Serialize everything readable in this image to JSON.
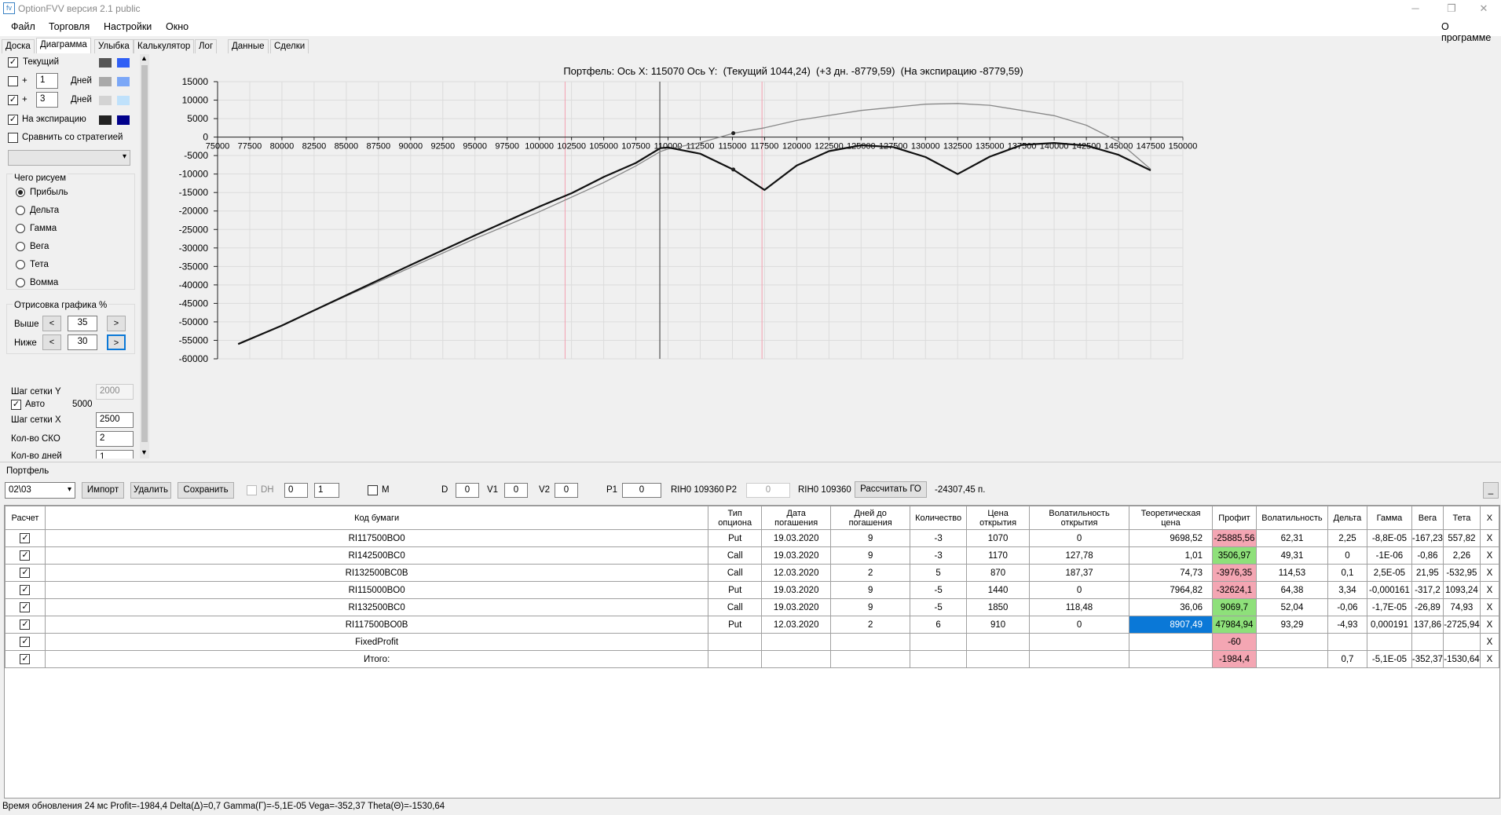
{
  "window": {
    "title": "OptionFVV версия 2.1 public",
    "minimize": "─",
    "restore": "❐",
    "close": "✕"
  },
  "menu": {
    "items": [
      "Файл",
      "Торговля",
      "Настройки",
      "Окно"
    ],
    "about": "О программе"
  },
  "tabs": [
    "Доска",
    "Диаграмма",
    "Улыбка",
    "Калькулятор",
    "Лог",
    "Данные",
    "Сделки"
  ],
  "left": {
    "current": {
      "label": "Текущий",
      "checked": true,
      "colors": [
        "#555555",
        "#2f5ff5"
      ]
    },
    "plus1": {
      "plus": "+",
      "days": "1",
      "unit": "Дней",
      "checked": false,
      "colors": [
        "#a9a9a9",
        "#7ba7f7"
      ]
    },
    "plus3": {
      "plus": "+",
      "days": "3",
      "unit": "Дней",
      "checked": true,
      "colors": [
        "#d3d3d3",
        "#bfe1fb"
      ]
    },
    "expiry": {
      "label": "На экспирацию",
      "checked": true,
      "colors": [
        "#222222",
        "#00008b"
      ]
    },
    "compare": {
      "label": "Сравнить со стратегией",
      "checked": false
    },
    "draw_group": "Чего рисуем",
    "radios": [
      "Прибыль",
      "Дельта",
      "Гамма",
      "Вега",
      "Тета",
      "Вомма"
    ],
    "selected_radio": "Прибыль",
    "render_group": "Отрисовка графика %",
    "above_label": "Выше",
    "above_value": "35",
    "below_label": "Ниже",
    "below_value": "30",
    "prev": "<",
    "next": ">",
    "grid_y_label": "Шаг сетки Y",
    "grid_y_value": "2000",
    "auto_label": "Авто",
    "auto_value": "5000",
    "auto_checked": true,
    "grid_x_label": "Шаг сетки X",
    "grid_x_value": "2500",
    "sko_label": "Кол-во СКО",
    "sko_value": "2",
    "days_label": "Кол-во дней",
    "days_value": "1"
  },
  "chart_data": {
    "type": "line",
    "title": "Портфель: Ось X: 115070 Ось Y:  (Текущий 1044,24)  (+3 дн. -8779,59)  (На экспирацию -8779,59)",
    "xlim": [
      75000,
      150000
    ],
    "ylim": [
      -60000,
      15000
    ],
    "x_ticks": [
      "75000",
      "77500",
      "80000",
      "82500",
      "85000",
      "87500",
      "90000",
      "92500",
      "95000",
      "97500",
      "100000",
      "102500",
      "105000",
      "107500",
      "110000",
      "112500",
      "115000",
      "117500",
      "120000",
      "122500",
      "125000",
      "127500",
      "130000",
      "132500",
      "135000",
      "137500",
      "140000",
      "142500",
      "145000",
      "147500",
      "150000"
    ],
    "y_ticks": [
      "15000",
      "10000",
      "5000",
      "0",
      "-5000",
      "-10000",
      "-15000",
      "-20000",
      "-25000",
      "-30000",
      "-35000",
      "-40000",
      "-45000",
      "-50000",
      "-55000",
      "-60000"
    ],
    "cursor_x": 109360,
    "pink_lines": [
      102000,
      117300
    ],
    "series": [
      {
        "color": "#888888",
        "x": [
          76600,
          80000,
          85000,
          90000,
          95000,
          100000,
          105000,
          107500,
          109400,
          110000,
          112500,
          115070,
          117500,
          120000,
          125000,
          130000,
          132500,
          135000,
          140000,
          142500,
          145000,
          147500
        ],
        "y": [
          -56000,
          -51000,
          -43000,
          -35300,
          -27500,
          -20200,
          -12300,
          -7800,
          -3900,
          -3200,
          -1500,
          1044,
          2500,
          4500,
          7200,
          8900,
          9100,
          8600,
          5800,
          3200,
          -1200,
          -8700
        ]
      },
      {
        "color": "#111111",
        "x": [
          76600,
          80000,
          85000,
          90000,
          95000,
          100000,
          102500,
          105000,
          107500,
          109400,
          110000,
          112500,
          115070,
          117500,
          120000,
          122500,
          125000,
          127500,
          130000,
          132500,
          135000,
          137500,
          140000,
          142500,
          145000,
          147500
        ],
        "y": [
          -56000,
          -51000,
          -42800,
          -34600,
          -26600,
          -18800,
          -15200,
          -10800,
          -7000,
          -3000,
          -2800,
          -4500,
          -8800,
          -14300,
          -7700,
          -3800,
          -2200,
          -2700,
          -5400,
          -10000,
          -5300,
          -2100,
          -1600,
          -2300,
          -4800,
          -9000
        ]
      }
    ],
    "markers": [
      {
        "x": 115070,
        "y": 1044
      },
      {
        "x": 115070,
        "y": -8780
      }
    ]
  },
  "portfolio": {
    "label": "Портфель",
    "date": "02\\03",
    "buttons": {
      "import": "Импорт",
      "delete": "Удалить",
      "save": "Сохранить",
      "calc": "Рассчитать ГО",
      "minimize": "_"
    },
    "dh": "DH",
    "dh_v1": "0",
    "dh_v2": "1",
    "m": "M",
    "d_label": "D",
    "d_value": "0",
    "v1_label": "V1",
    "v1_value": "0",
    "v2_label": "V2",
    "v2_value": "0",
    "p1_label": "P1",
    "p1_value": "0",
    "rih1": "RIH0 109360",
    "p2_label": "P2",
    "p2_value": "0",
    "rih2": "RIH0 109360",
    "go_result": "-24307,45 п."
  },
  "table": {
    "headers": [
      "Расчет",
      "Код бумаги",
      "Тип\nопциона",
      "Дата\nпогашения",
      "Дней до\nпогашения",
      "Количество",
      "Цена\nоткрытия",
      "Волатильность\nоткрытия",
      "Теоретическая\nцена",
      "Профит",
      "Волатильность",
      "Дельта",
      "Гамма",
      "Вега",
      "Тета",
      "X"
    ],
    "rows": [
      [
        "RI117500BO0",
        "Put",
        "19.03.2020",
        "9",
        "-3",
        "1070",
        "0",
        "9698,52",
        "-25885,56",
        "62,31",
        "2,25",
        "-8,8E-05",
        "-167,23",
        "557,82"
      ],
      [
        "RI142500BC0",
        "Call",
        "19.03.2020",
        "9",
        "-3",
        "1170",
        "127,78",
        "1,01",
        "3506,97",
        "49,31",
        "0",
        "-1E-06",
        "-0,86",
        "2,26"
      ],
      [
        "RI132500BC0B",
        "Call",
        "12.03.2020",
        "2",
        "5",
        "870",
        "187,37",
        "74,73",
        "-3976,35",
        "114,53",
        "0,1",
        "2,5E-05",
        "21,95",
        "-532,95"
      ],
      [
        "RI115000BO0",
        "Put",
        "19.03.2020",
        "9",
        "-5",
        "1440",
        "0",
        "7964,82",
        "-32624,1",
        "64,38",
        "3,34",
        "-0,000161",
        "-317,2",
        "1093,24"
      ],
      [
        "RI132500BC0",
        "Call",
        "19.03.2020",
        "9",
        "-5",
        "1850",
        "118,48",
        "36,06",
        "9069,7",
        "52,04",
        "-0,06",
        "-1,7E-05",
        "-26,89",
        "74,93"
      ],
      [
        "RI117500BO0B",
        "Put",
        "12.03.2020",
        "2",
        "6",
        "910",
        "0",
        "8907,49",
        "47984,94",
        "93,29",
        "-4,93",
        "0,000191",
        "137,86",
        "-2725,94"
      ],
      [
        "FixedProfit",
        "",
        "",
        "",
        "",
        "",
        "",
        "",
        "-60",
        "",
        "",
        "",
        "",
        ""
      ],
      [
        "Итого:",
        "",
        "",
        "",
        "",
        "",
        "",
        "",
        "-1984,4",
        "",
        "0,7",
        "-5,1E-05",
        "-352,37",
        "-1530,64"
      ]
    ],
    "x_label": "X"
  },
  "status": "Время обновления 24 мс  Profit=-1984,4 Delta(Δ)=0,7 Gamma(Г)=-5,1E-05 Vega=-352,37 Theta(Θ)=-1530,64"
}
